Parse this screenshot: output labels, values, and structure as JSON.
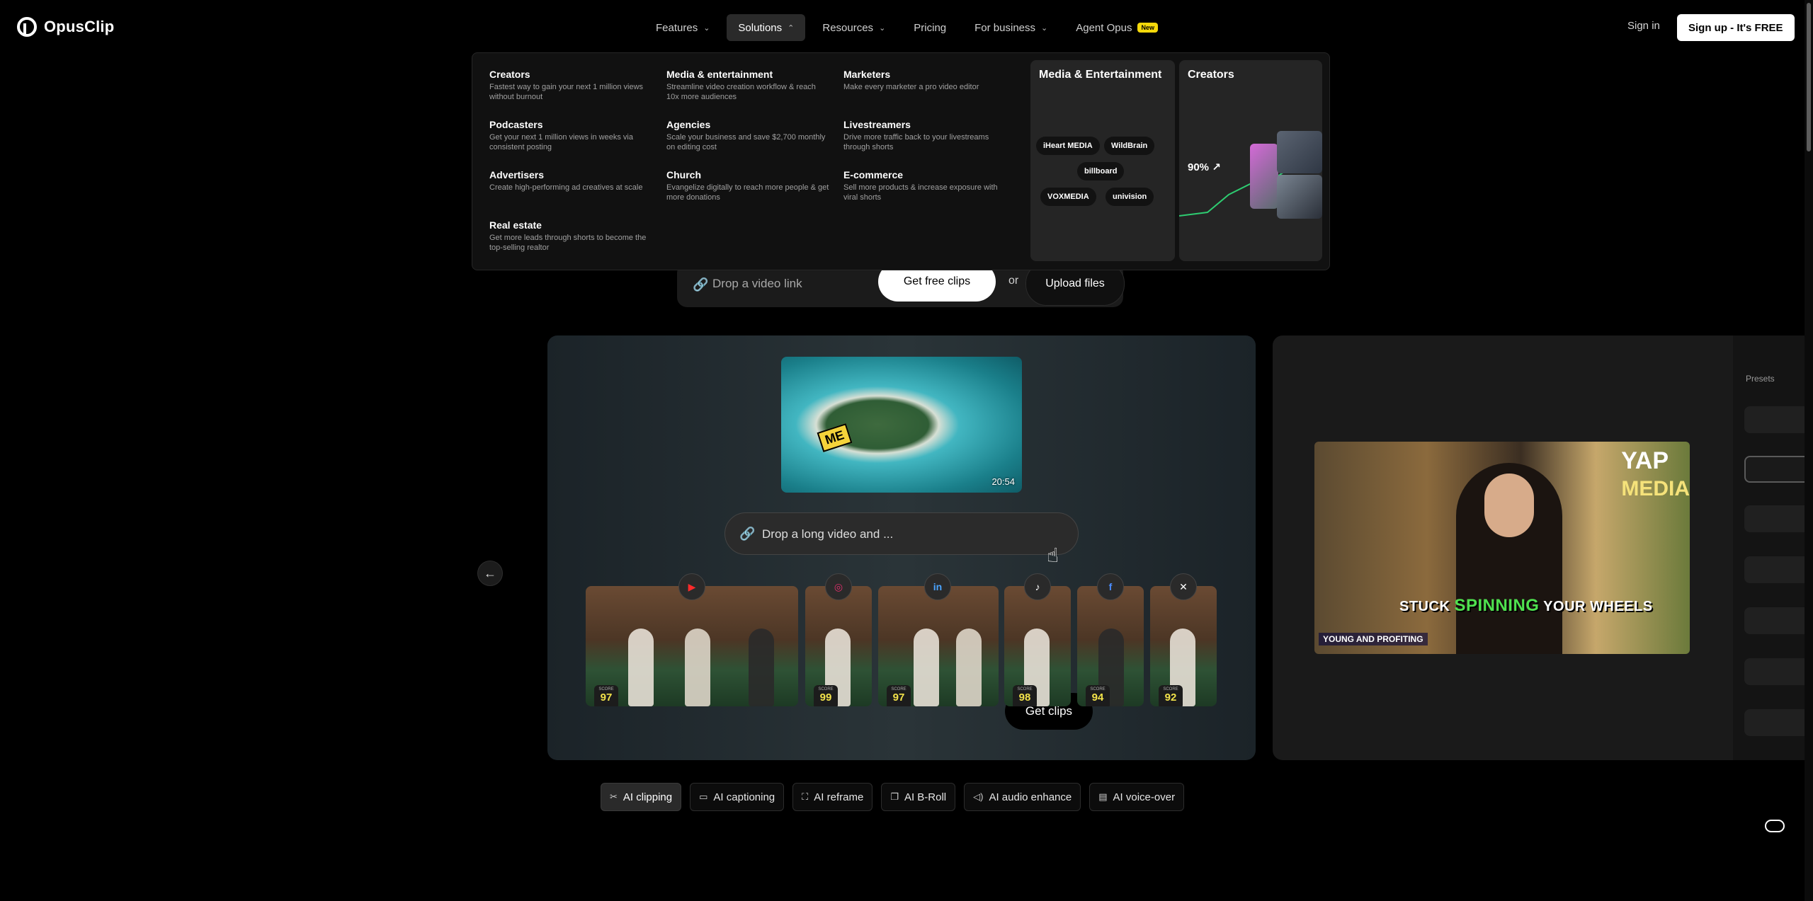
{
  "brand": {
    "name": "OpusClip"
  },
  "nav": {
    "items": [
      {
        "label": "Features",
        "chevron": "down"
      },
      {
        "label": "Solutions",
        "chevron": "up",
        "active": true
      },
      {
        "label": "Resources",
        "chevron": "down"
      },
      {
        "label": "Pricing"
      },
      {
        "label": "For business",
        "chevron": "down"
      },
      {
        "label": "Agent Opus",
        "badge": "New"
      }
    ],
    "signin": "Sign in",
    "signup": "Sign up - It's FREE"
  },
  "solutions_menu": {
    "items": [
      {
        "title": "Creators",
        "desc": "Fastest way to gain your next 1 million views without burnout"
      },
      {
        "title": "Media & entertainment",
        "desc": "Streamline video creation workflow & reach 10x more audiences"
      },
      {
        "title": "Marketers",
        "desc": "Make every marketer a pro video editor"
      },
      {
        "title": "Podcasters",
        "desc": "Get your next 1 million views in weeks via consistent posting"
      },
      {
        "title": "Agencies",
        "desc": "Scale your business and save $2,700 monthly on editing cost"
      },
      {
        "title": "Livestreamers",
        "desc": "Drive more traffic back to your livestreams through shorts"
      },
      {
        "title": "Advertisers",
        "desc": "Create high-performing ad creatives at scale"
      },
      {
        "title": "Church",
        "desc": "Evangelize digitally to reach more people & get more donations"
      },
      {
        "title": "E-commerce",
        "desc": "Sell more products & increase exposure with viral shorts"
      },
      {
        "title": "Real estate",
        "desc": "Get more leads through shorts to become the top-selling realtor"
      }
    ],
    "card_media": {
      "title": "Media & Entertainment",
      "brands": [
        "iHeart MEDIA",
        "WildBrain",
        "billboard",
        "VOXMEDIA",
        "univision"
      ]
    },
    "card_creators": {
      "title": "Creators",
      "metric": "90% ↗"
    }
  },
  "hero_input": {
    "placeholder": "Drop a video link",
    "get_free_clips": "Get free clips",
    "or": "or",
    "upload": "Upload files"
  },
  "slide_main": {
    "thumb_tag": "ME",
    "duration": "20:54",
    "long_input_placeholder": "Drop a long video and ...",
    "get_clips": "Get clips",
    "clips": [
      {
        "score_label": "SCORE",
        "score": "97",
        "platform": "youtube"
      },
      {
        "score_label": "SCORE",
        "score": "99",
        "platform": "instagram"
      },
      {
        "score_label": "SCORE",
        "score": "97",
        "platform": "linkedin"
      },
      {
        "score_label": "SCORE",
        "score": "98",
        "platform": "tiktok"
      },
      {
        "score_label": "SCORE",
        "score": "94",
        "platform": "facebook"
      },
      {
        "score_label": "SCORE",
        "score": "92",
        "platform": "x"
      }
    ]
  },
  "slide_next": {
    "yap": "YAP",
    "media": "MEDIA",
    "caption_before": "STUCK",
    "caption_highlight": "SPINNING",
    "caption_after": "YOUR WHEELS",
    "footer": "YOUNG AND PROFITING",
    "presets_label": "Presets"
  },
  "feature_tabs": [
    {
      "label": "AI clipping",
      "icon": "scissors-icon",
      "active": true
    },
    {
      "label": "AI captioning",
      "icon": "caption-icon"
    },
    {
      "label": "AI reframe",
      "icon": "reframe-icon"
    },
    {
      "label": "AI B-Roll",
      "icon": "broll-icon"
    },
    {
      "label": "AI audio enhance",
      "icon": "speaker-icon"
    },
    {
      "label": "AI voice-over",
      "icon": "voiceover-icon"
    }
  ]
}
